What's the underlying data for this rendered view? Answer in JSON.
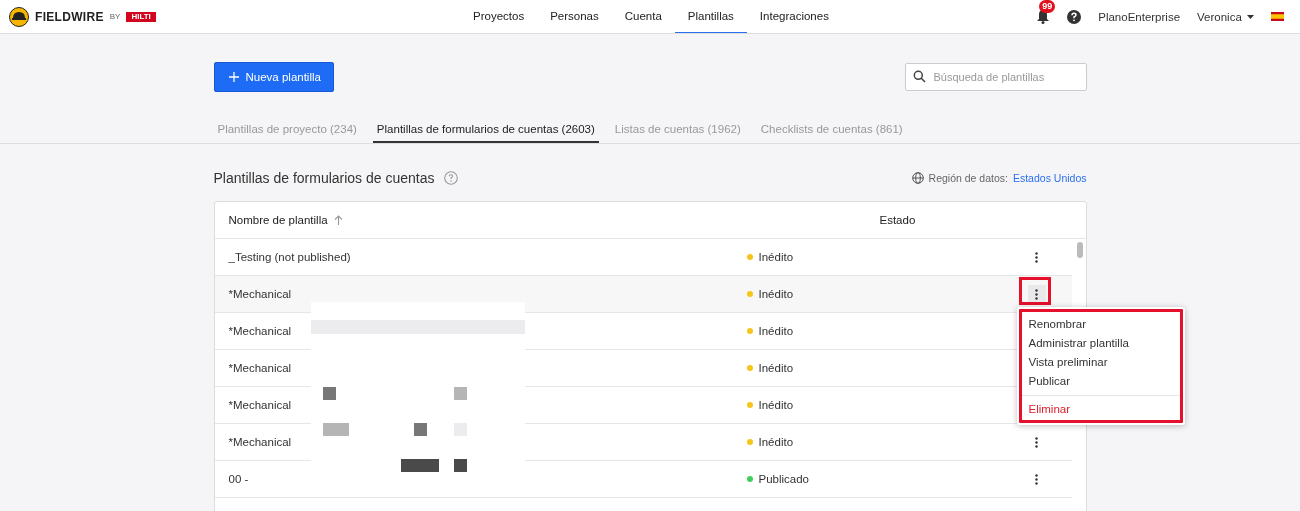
{
  "header": {
    "brand": "FIELDWIRE",
    "by": "BY",
    "partner": "HILTI",
    "nav": [
      {
        "label": "Proyectos",
        "selected": false
      },
      {
        "label": "Personas",
        "selected": false
      },
      {
        "label": "Cuenta",
        "selected": false
      },
      {
        "label": "Plantillas",
        "selected": true
      },
      {
        "label": "Integraciones",
        "selected": false
      }
    ],
    "notifications": "99",
    "account": "PlanoEnterprise",
    "user": "Veronica"
  },
  "toolbar": {
    "new_button": "Nueva plantilla",
    "search": {
      "placeholder": "Búsqueda de plantillas"
    }
  },
  "tabs": [
    {
      "label": "Plantillas de proyecto (234)",
      "selected": false
    },
    {
      "label": "Plantillas de formularios de cuentas (2603)",
      "selected": true
    },
    {
      "label": "Listas de cuentas (1962)",
      "selected": false
    },
    {
      "label": "Checklists de cuentas (861)",
      "selected": false
    }
  ],
  "section": {
    "title": "Plantillas de formularios de cuentas",
    "region_label": "Región de datos:",
    "region_link": "Estados Unidos"
  },
  "table": {
    "columns": [
      "Nombre de plantilla",
      "Estado"
    ],
    "rows": [
      {
        "name": "_Testing (not published)",
        "status": "Inédito",
        "color": "#f5c518",
        "menu_open": false
      },
      {
        "name": "*Mechanical",
        "status": "Inédito",
        "color": "#f5c518",
        "menu_open": true
      },
      {
        "name": "*Mechanical",
        "status": "Inédito",
        "color": "#f5c518",
        "menu_open": false
      },
      {
        "name": "*Mechanical",
        "status": "Inédito",
        "color": "#f5c518",
        "menu_open": false
      },
      {
        "name": "*Mechanical",
        "status": "Inédito",
        "color": "#f5c518",
        "menu_open": false
      },
      {
        "name": "*Mechanical",
        "status": "Inédito",
        "color": "#f5c518",
        "menu_open": false
      },
      {
        "name": "00 -",
        "status": "Publicado",
        "color": "#3fcf5a",
        "menu_open": false
      }
    ]
  },
  "menu": {
    "items": [
      {
        "label": "Renombrar",
        "kind": "normal"
      },
      {
        "label": "Administrar plantilla",
        "kind": "normal"
      },
      {
        "label": "Vista preliminar",
        "kind": "normal"
      },
      {
        "label": "Publicar",
        "kind": "normal"
      },
      {
        "label": "Eliminar",
        "kind": "danger"
      }
    ]
  }
}
